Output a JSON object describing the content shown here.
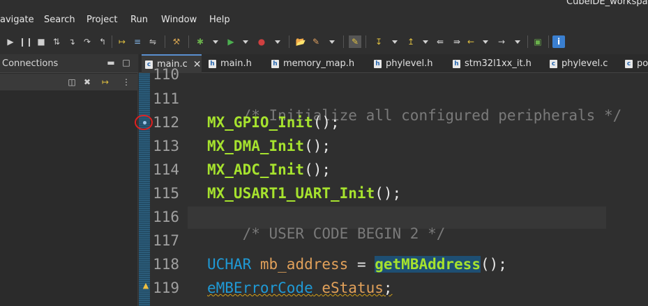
{
  "window": {
    "title": "CubeIDE_workspac"
  },
  "menu": [
    "avigate",
    "Search",
    "Project",
    "Run",
    "Window",
    "Help"
  ],
  "toolbar": {
    "icons": [
      "resume-icon",
      "suspend-icon",
      "terminate-icon",
      "disconnect-icon",
      "step-into-icon",
      "step-over-icon",
      "step-return-icon",
      "instruction-stepping-icon",
      "debug-icon",
      "run-icon",
      "external-tools-icon",
      "open-type-icon",
      "search-icon",
      "annotation-icon",
      "back-icon",
      "forward-icon",
      "info-icon"
    ]
  },
  "left_panel": {
    "title": "Connections",
    "controls": [
      "minimize",
      "maximize"
    ]
  },
  "tabs": [
    {
      "label": "main.c",
      "active": true
    },
    {
      "label": "main.h",
      "active": false
    },
    {
      "label": "memory_map.h",
      "active": false
    },
    {
      "label": "phylevel.h",
      "active": false
    },
    {
      "label": "stm32l1xx_it.h",
      "active": false
    },
    {
      "label": "phylevel.c",
      "active": false
    },
    {
      "label": "po",
      "active": false
    }
  ],
  "editor": {
    "line_numbers": [
      "110",
      "111",
      "112",
      "113",
      "114",
      "115",
      "116",
      "117",
      "118",
      "119"
    ],
    "lines": {
      "l110": "",
      "l111": "/* Initialize all configured peripherals */",
      "l112_fn": "MX_GPIO_Init",
      "l112_rest": "();",
      "l113_fn": "MX_DMA_Init",
      "l113_rest": "();",
      "l114_fn": "MX_ADC_Init",
      "l114_rest": "();",
      "l115_fn": "MX_USART1_UART_Init",
      "l115_rest": "();",
      "l116": "/* USER CODE BEGIN 2 */",
      "l117": "",
      "l118_type": "UCHAR",
      "l118_var": "mb_address",
      "l118_eq": " = ",
      "l118_fn": "getMBAddress",
      "l118_rest": "();",
      "l119_type": "eMBErrorCode",
      "l119_var": "eStatus",
      "l119_rest": ";"
    }
  },
  "colors": {
    "function": "#a6e22e",
    "type": "#1f9ad6",
    "variable": "#e2a15a",
    "comment": "#7a7a7a",
    "highlight": "#1e4f73"
  }
}
